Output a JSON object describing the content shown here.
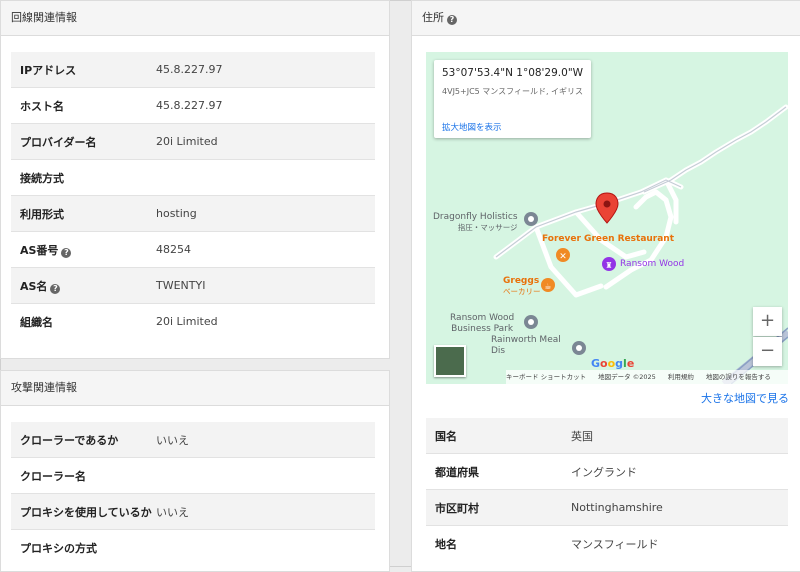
{
  "line_section": {
    "title": "回線関連情報",
    "rows": [
      {
        "key": "IPアドレス",
        "value": "45.8.227.97",
        "help": false
      },
      {
        "key": "ホスト名",
        "value": "45.8.227.97",
        "help": false
      },
      {
        "key": "プロバイダー名",
        "value": "20i Limited",
        "help": false
      },
      {
        "key": "接続方式",
        "value": "",
        "help": false
      },
      {
        "key": "利用形式",
        "value": "hosting",
        "help": false
      },
      {
        "key": "AS番号",
        "value": "48254",
        "help": true
      },
      {
        "key": "AS名",
        "value": "TWENTYI",
        "help": true
      },
      {
        "key": "組織名",
        "value": "20i Limited",
        "help": false
      }
    ]
  },
  "attack_section": {
    "title": "攻撃関連情報",
    "rows": [
      {
        "key": "クローラーであるか",
        "value": "いいえ"
      },
      {
        "key": "クローラー名",
        "value": ""
      },
      {
        "key": "プロキシを使用しているか",
        "value": "いいえ"
      },
      {
        "key": "プロキシの方式",
        "value": ""
      }
    ]
  },
  "address_section": {
    "title": "住所",
    "help_glyph": "?",
    "bigmap_link": "大きな地図で見る",
    "rows": [
      {
        "key": "国名",
        "value": "英国"
      },
      {
        "key": "都道府県",
        "value": "イングランド"
      },
      {
        "key": "市区町村",
        "value": "Nottinghamshire"
      },
      {
        "key": "地名",
        "value": "マンスフィールド"
      }
    ]
  },
  "map": {
    "coord": "53°07'53.4\"N 1°08'29.0\"W",
    "address": "4VJ5+JC5 マンスフィールド, イギリス",
    "enlarge_link": "拡大地図を表示",
    "pois": {
      "dragonfly": "Dragonfly Holistics",
      "dragonfly_sub": "指圧・マッサージ",
      "forever_green": "Forever Green Restaurant",
      "ransom_wood": "Ransom Wood",
      "greggs": "Greggs",
      "greggs_sub": "ベーカリー",
      "business_park_1": "Ransom Wood",
      "business_park_2": "Business Park",
      "rainworth_1": "Rainworth Meal",
      "rainworth_2": "Dis"
    },
    "zoom_in": "+",
    "zoom_out": "−",
    "google_logo": "Google",
    "footer": {
      "shortcuts": "キーボード ショートカット",
      "map_data": "地図データ ©2025",
      "terms": "利用規約",
      "report": "地図の誤りを報告する"
    },
    "colors": {
      "background": "#d6f5e2",
      "pin": "#ea4335",
      "road": "#ffffff",
      "link": "#1a73e8"
    }
  }
}
